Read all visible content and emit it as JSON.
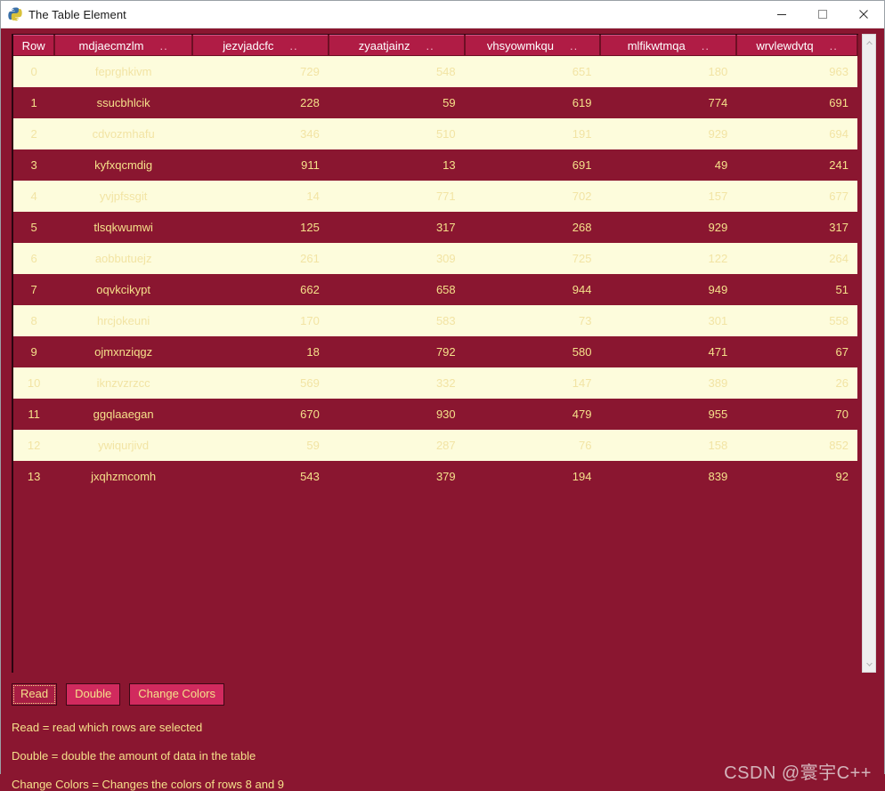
{
  "window": {
    "title": "The Table Element",
    "icon": "python-logo-icon",
    "controls": {
      "minimize": "minimize-icon",
      "maximize": "maximize-icon",
      "close": "close-icon"
    }
  },
  "theme": {
    "dark_red": "#8a1630",
    "header_red": "#b01c45",
    "light_yellow_bg": "#fdfcdc",
    "yellow_text": "#f5e08a",
    "pale_yellow_text": "#f2e4a4",
    "button_pink": "#d12a5e",
    "header_text": "#ffffff"
  },
  "table": {
    "headers": [
      {
        "label": "Row",
        "dots": ""
      },
      {
        "label": "mdjaecmzlm",
        "dots": ".."
      },
      {
        "label": "jezvjadcfc",
        "dots": ".."
      },
      {
        "label": "zyaatjainz",
        "dots": ".."
      },
      {
        "label": "vhsyowmkqu",
        "dots": ".."
      },
      {
        "label": "mlfikwtmqa",
        "dots": ".."
      },
      {
        "label": "wrvlewdvtq",
        "dots": ".."
      }
    ],
    "rows": [
      {
        "row": "0",
        "name": "feprghkivm",
        "v1": "729",
        "v2": "548",
        "v3": "651",
        "v4": "180",
        "v5": "963"
      },
      {
        "row": "1",
        "name": "ssucbhlcik",
        "v1": "228",
        "v2": "59",
        "v3": "619",
        "v4": "774",
        "v5": "691"
      },
      {
        "row": "2",
        "name": "cdvozmhafu",
        "v1": "346",
        "v2": "510",
        "v3": "191",
        "v4": "929",
        "v5": "694"
      },
      {
        "row": "3",
        "name": "kyfxqcmdig",
        "v1": "911",
        "v2": "13",
        "v3": "691",
        "v4": "49",
        "v5": "241"
      },
      {
        "row": "4",
        "name": "yvjpfssgit",
        "v1": "14",
        "v2": "771",
        "v3": "702",
        "v4": "157",
        "v5": "677"
      },
      {
        "row": "5",
        "name": "tlsqkwumwi",
        "v1": "125",
        "v2": "317",
        "v3": "268",
        "v4": "929",
        "v5": "317"
      },
      {
        "row": "6",
        "name": "aobbutuejz",
        "v1": "261",
        "v2": "309",
        "v3": "725",
        "v4": "122",
        "v5": "264"
      },
      {
        "row": "7",
        "name": "oqvkcikypt",
        "v1": "662",
        "v2": "658",
        "v3": "944",
        "v4": "949",
        "v5": "51"
      },
      {
        "row": "8",
        "name": "hrcjokeuni",
        "v1": "170",
        "v2": "583",
        "v3": "73",
        "v4": "301",
        "v5": "558"
      },
      {
        "row": "9",
        "name": "ojmxnziqgz",
        "v1": "18",
        "v2": "792",
        "v3": "580",
        "v4": "471",
        "v5": "67"
      },
      {
        "row": "10",
        "name": "iknzvzrzcc",
        "v1": "569",
        "v2": "332",
        "v3": "147",
        "v4": "389",
        "v5": "26"
      },
      {
        "row": "11",
        "name": "ggqlaaegan",
        "v1": "670",
        "v2": "930",
        "v3": "479",
        "v4": "955",
        "v5": "70"
      },
      {
        "row": "12",
        "name": "ywiqurjivd",
        "v1": "59",
        "v2": "287",
        "v3": "76",
        "v4": "158",
        "v5": "852"
      },
      {
        "row": "13",
        "name": "jxqhzmcomh",
        "v1": "543",
        "v2": "379",
        "v3": "194",
        "v4": "839",
        "v5": "92"
      }
    ]
  },
  "scrollbar": {
    "up_arrow": "chevron-up-icon",
    "down_arrow": "chevron-down-icon"
  },
  "buttons": [
    {
      "label": "Read",
      "focused": true
    },
    {
      "label": "Double",
      "focused": false
    },
    {
      "label": "Change Colors",
      "focused": false
    }
  ],
  "help": [
    "Read = read which rows are selected",
    "Double = double the amount of data in the table",
    "Change Colors = Changes the colors of rows 8 and 9"
  ],
  "watermark": "CSDN @寰宇C++"
}
